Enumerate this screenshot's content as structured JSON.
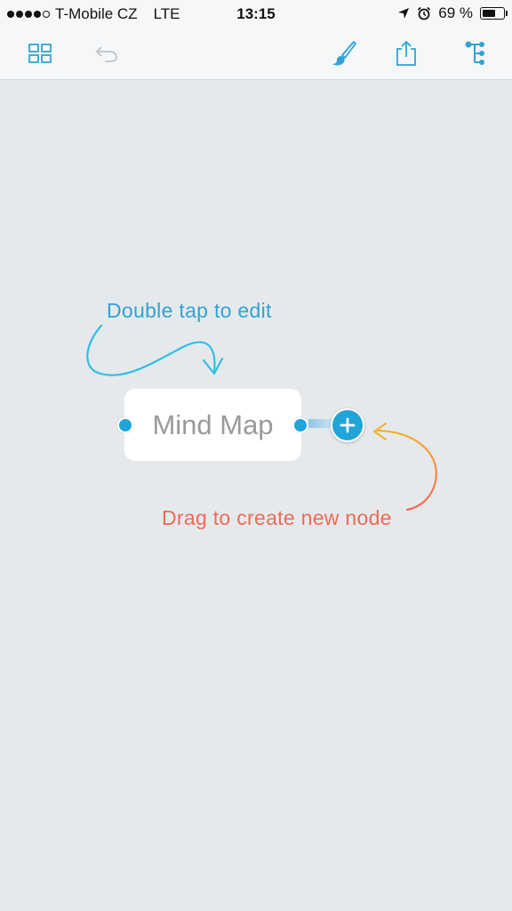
{
  "status_bar": {
    "carrier": "T-Mobile CZ",
    "network": "LTE",
    "time": "13:15",
    "battery": "69 %",
    "battery_level": 0.69,
    "signal_bars": 4,
    "signal_total": 5
  },
  "toolbar": {
    "icons": [
      "grid-view-icon",
      "undo-icon",
      "brush-icon",
      "share-icon",
      "outline-tree-icon"
    ]
  },
  "canvas": {
    "hint_edit": "Double tap to edit",
    "hint_drag": "Drag to create new node",
    "node_title": "Mind Map"
  },
  "colors": {
    "accent": "#21a4d8",
    "hint_blue": "#2fa3d6",
    "hint_red": "#ef6a55",
    "hint_orange": "#f5b233",
    "background": "#e6e9ec"
  }
}
